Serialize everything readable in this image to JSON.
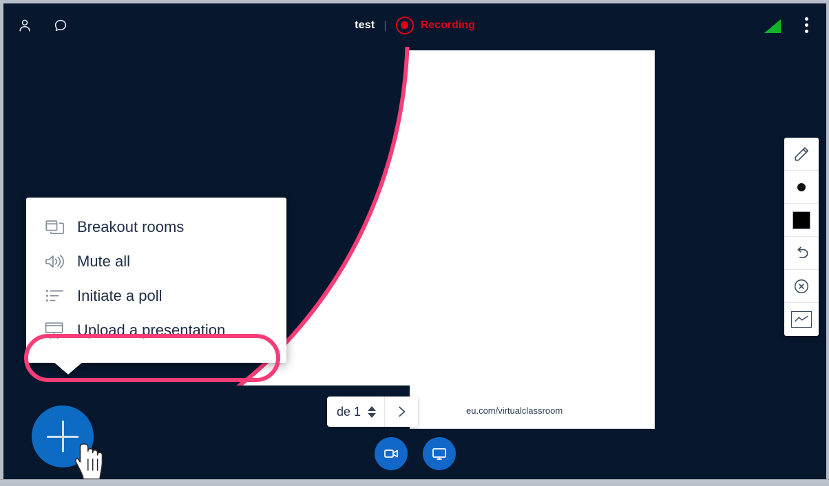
{
  "app": {
    "background_color": "#07172e",
    "accent_color": "#1168c8",
    "annotation_color": "#f73d77",
    "recording_color": "#e00016"
  },
  "topbar": {
    "participants_icon": "person-icon",
    "chat_icon": "chat-bubble-icon",
    "meeting_title": "test",
    "separator": "|",
    "recording_label": "Recording",
    "recording_icon": "record-dot-icon",
    "signal_icon": "signal-strength-icon",
    "more_icon": "kebab-menu-icon"
  },
  "menu": {
    "items": [
      {
        "label": "Breakout rooms",
        "icon": "windows-rooms-icon"
      },
      {
        "label": "Mute all",
        "icon": "speaker-icon"
      },
      {
        "label": "Initiate a poll",
        "icon": "list-poll-icon"
      },
      {
        "label": "Upload a presentation",
        "icon": "presentation-screen-icon"
      }
    ],
    "highlighted_item_index": 3
  },
  "fab": {
    "label": "+",
    "name": "add-action-button"
  },
  "cursor": {
    "type": "pointing-hand-cursor"
  },
  "bottom_controls": [
    {
      "name": "camera-toggle-button",
      "icon": "video-camera-icon"
    },
    {
      "name": "screenshare-button",
      "icon": "monitor-screen-icon"
    }
  ],
  "slide_pager": {
    "page_label": "de 1",
    "spinner_icon": "up-down-spinner-icon",
    "next_icon": "chevron-right-icon",
    "url_text": "eu.com/virtualclassroom"
  },
  "tool_rail": {
    "tools": [
      {
        "name": "pen-tool",
        "icon": "pencil-icon"
      },
      {
        "name": "thickness-tool",
        "icon": "dot-icon"
      },
      {
        "name": "color-tool",
        "icon": "black-square-swatch-icon",
        "color": "#000000"
      },
      {
        "name": "undo-tool",
        "icon": "undo-arrow-icon"
      },
      {
        "name": "clear-tool",
        "icon": "circle-x-icon"
      },
      {
        "name": "shape-tool",
        "icon": "line-graph-icon"
      }
    ]
  }
}
